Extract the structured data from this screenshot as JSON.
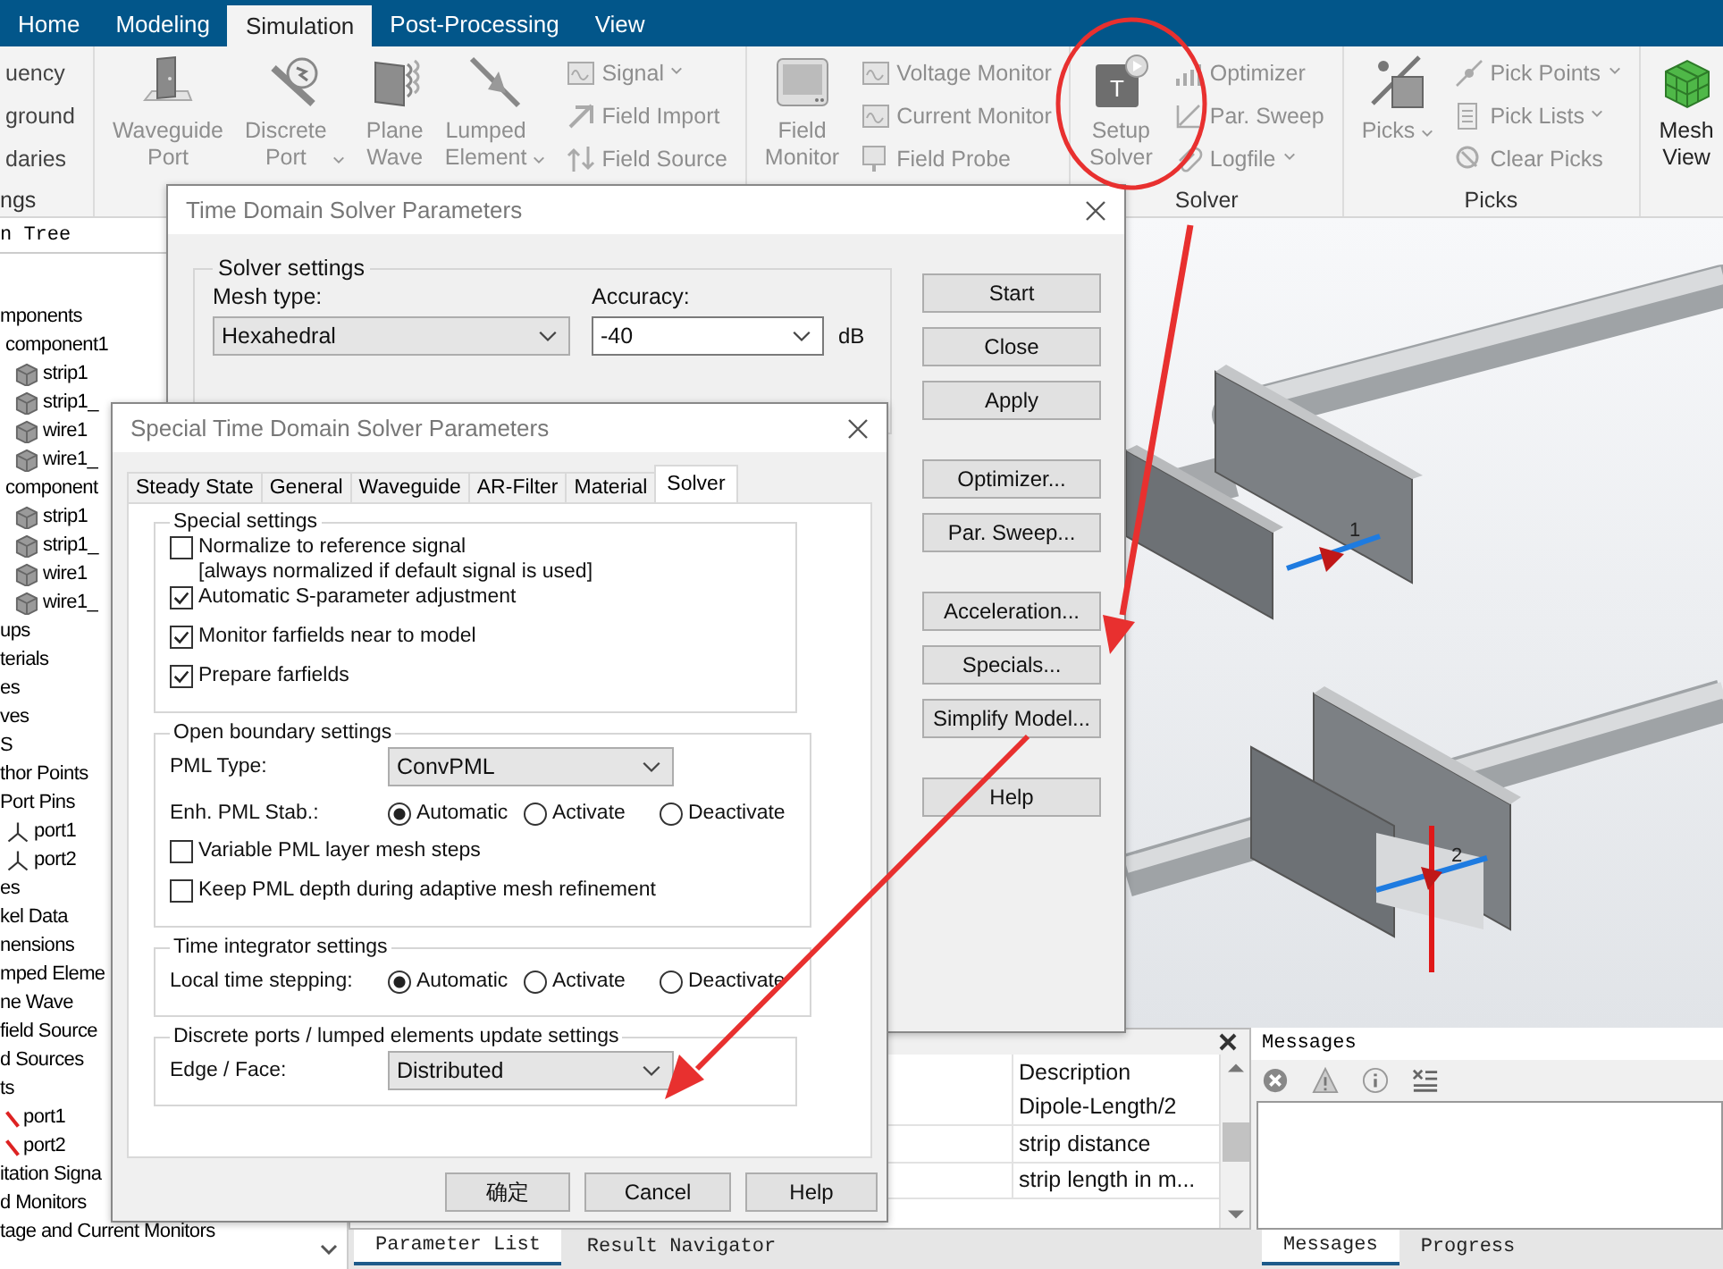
{
  "menu_tabs": [
    {
      "label": "Home",
      "selected": false
    },
    {
      "label": "Modeling",
      "selected": false
    },
    {
      "label": "Simulation",
      "selected": true
    },
    {
      "label": "Post-Processing",
      "selected": false
    },
    {
      "label": "View",
      "selected": false
    }
  ],
  "ribbon": {
    "groups": [
      {
        "label": "ngs",
        "items": [
          {
            "kind": "small",
            "label": "uency",
            "disabled": false
          },
          {
            "kind": "small",
            "label": "ground",
            "disabled": false
          },
          {
            "kind": "small",
            "label": "daries",
            "disabled": false
          }
        ]
      },
      {
        "items": [
          {
            "kind": "large",
            "label": "Waveguide Port",
            "disabled": true,
            "dropdown": false
          },
          {
            "kind": "large",
            "label": "Discrete Port",
            "disabled": true,
            "dropdown": true
          },
          {
            "kind": "large",
            "label": "Plane Wave",
            "disabled": true,
            "dropdown": false
          },
          {
            "kind": "large",
            "label": "Lumped Element",
            "disabled": true,
            "dropdown": true
          },
          {
            "kind": "small",
            "label": "Signal",
            "disabled": true,
            "dropdown": true
          },
          {
            "kind": "small",
            "label": "Field Import",
            "disabled": true,
            "dropdown": false
          },
          {
            "kind": "small",
            "label": "Field Source",
            "disabled": true,
            "dropdown": false
          }
        ]
      },
      {
        "items": [
          {
            "kind": "large",
            "label": "Field Monitor",
            "disabled": true,
            "dropdown": false
          },
          {
            "kind": "small",
            "label": "Voltage Monitor",
            "disabled": true,
            "dropdown": false
          },
          {
            "kind": "small",
            "label": "Current Monitor",
            "disabled": true,
            "dropdown": false
          },
          {
            "kind": "small",
            "label": "Field Probe",
            "disabled": true,
            "dropdown": false
          }
        ]
      },
      {
        "label": "Solver",
        "items": [
          {
            "kind": "large",
            "label": "Setup Solver",
            "badge": "T",
            "disabled": true,
            "dropdown": false
          },
          {
            "kind": "small",
            "label": "Optimizer",
            "disabled": true,
            "dropdown": false
          },
          {
            "kind": "small",
            "label": "Par. Sweep",
            "disabled": true,
            "dropdown": false
          },
          {
            "kind": "small",
            "label": "Logfile",
            "disabled": true,
            "dropdown": true
          }
        ]
      },
      {
        "label": "Picks",
        "items": [
          {
            "kind": "large",
            "label": "Picks",
            "disabled": true,
            "dropdown": true
          },
          {
            "kind": "small",
            "label": "Pick Points",
            "disabled": true,
            "dropdown": true
          },
          {
            "kind": "small",
            "label": "Pick Lists",
            "disabled": true,
            "dropdown": true
          },
          {
            "kind": "small",
            "label": "Clear Picks",
            "disabled": true,
            "dropdown": false
          }
        ]
      },
      {
        "items": [
          {
            "kind": "large",
            "label": "Mesh View",
            "disabled": false,
            "dropdown": false
          }
        ]
      }
    ]
  },
  "model_tree": {
    "header": "n Tree",
    "items": [
      {
        "label": "mponents",
        "children": [
          {
            "label": "component1",
            "children": [
              {
                "label": "strip1",
                "kind": "solid"
              },
              {
                "label": "strip1_",
                "kind": "solid"
              },
              {
                "label": "wire1",
                "kind": "solid"
              },
              {
                "label": "wire1_",
                "kind": "solid"
              }
            ]
          },
          {
            "label": "component",
            "children": [
              {
                "label": "strip1",
                "kind": "solid"
              },
              {
                "label": "strip1_",
                "kind": "solid"
              },
              {
                "label": "wire1",
                "kind": "solid"
              },
              {
                "label": "wire1_",
                "kind": "solid"
              }
            ]
          }
        ]
      },
      {
        "label": "ups"
      },
      {
        "label": "terials"
      },
      {
        "label": "es"
      },
      {
        "label": "ves"
      },
      {
        "label": "S"
      },
      {
        "label": "thor Points"
      },
      {
        "label": "Port Pins",
        "children": [
          {
            "label": "port1",
            "kind": "pin"
          },
          {
            "label": "port2",
            "kind": "pin"
          }
        ]
      },
      {
        "label": "es"
      },
      {
        "label": "kel Data"
      },
      {
        "label": "nensions"
      },
      {
        "label": "mped Eleme"
      },
      {
        "label": "ne Wave"
      },
      {
        "label": "field Source"
      },
      {
        "label": "d Sources"
      },
      {
        "label": "ts",
        "children": [
          {
            "label": "port1",
            "kind": "port"
          },
          {
            "label": "port2",
            "kind": "port"
          }
        ]
      },
      {
        "label": "itation Signa"
      },
      {
        "label": "d Monitors"
      },
      {
        "label": "tage and Current Monitors"
      }
    ]
  },
  "viewport": {
    "port_labels": [
      "1",
      "2"
    ]
  },
  "parameter_list": {
    "column": "Description",
    "rows": [
      "Dipole-Length/2",
      "strip distance",
      "strip length in m..."
    ]
  },
  "bottom_tabs": [
    {
      "label": "Parameter List",
      "selected": true
    },
    {
      "label": "Result Navigator",
      "selected": false
    }
  ],
  "messages": {
    "title": "Messages",
    "tabs": [
      {
        "label": "Messages",
        "selected": true
      },
      {
        "label": "Progress",
        "selected": false
      }
    ]
  },
  "solver_dialog": {
    "title": "Time Domain Solver Parameters",
    "group": "Solver settings",
    "mesh_type": {
      "label": "Mesh type:",
      "value": "Hexahedral"
    },
    "accuracy": {
      "label": "Accuracy:",
      "value": "-40",
      "unit": "dB"
    },
    "button_groups": [
      [
        "Start",
        "Close",
        "Apply"
      ],
      [
        "Optimizer...",
        "Par. Sweep..."
      ],
      [
        "Acceleration...",
        "Specials...",
        "Simplify Model..."
      ],
      [
        "Help"
      ]
    ]
  },
  "special_dialog": {
    "title": "Special Time Domain Solver Parameters",
    "tabs": [
      {
        "label": "Steady State",
        "selected": false
      },
      {
        "label": "General",
        "selected": false
      },
      {
        "label": "Waveguide",
        "selected": false
      },
      {
        "label": "AR-Filter",
        "selected": false
      },
      {
        "label": "Material",
        "selected": false
      },
      {
        "label": "Solver",
        "selected": true
      }
    ],
    "sections": [
      {
        "title": "Special settings",
        "rows": [
          {
            "kind": "checkbox",
            "label": "Normalize to reference signal",
            "note": "[always normalized if default signal is used]",
            "checked": false
          },
          {
            "kind": "checkbox",
            "label": "Automatic S-parameter adjustment",
            "checked": true
          },
          {
            "kind": "checkbox",
            "label": "Monitor farfields near to model",
            "checked": true
          },
          {
            "kind": "checkbox",
            "label": "Prepare farfields",
            "checked": true
          }
        ]
      },
      {
        "title": "Open boundary settings",
        "rows": [
          {
            "kind": "dropdown",
            "label": "PML Type:",
            "value": "ConvPML"
          },
          {
            "kind": "radio",
            "label": "Enh. PML Stab.:",
            "options": [
              {
                "label": "Automatic",
                "selected": true
              },
              {
                "label": "Activate",
                "selected": false
              },
              {
                "label": "Deactivate",
                "selected": false
              }
            ]
          },
          {
            "kind": "checkbox",
            "label": "Variable PML layer mesh steps",
            "checked": false
          },
          {
            "kind": "checkbox",
            "label": "Keep PML depth during adaptive mesh refinement",
            "checked": false
          }
        ]
      },
      {
        "title": "Time integrator settings",
        "rows": [
          {
            "kind": "radio",
            "label": "Local time stepping:",
            "options": [
              {
                "label": "Automatic",
                "selected": true
              },
              {
                "label": "Activate",
                "selected": false
              },
              {
                "label": "Deactivate",
                "selected": false
              }
            ]
          }
        ]
      },
      {
        "title": "Discrete ports / lumped elements update settings",
        "rows": [
          {
            "kind": "dropdown",
            "label": "Edge / Face:",
            "value": "Distributed"
          }
        ]
      }
    ],
    "buttons": [
      "确定",
      "Cancel",
      "Help"
    ]
  }
}
